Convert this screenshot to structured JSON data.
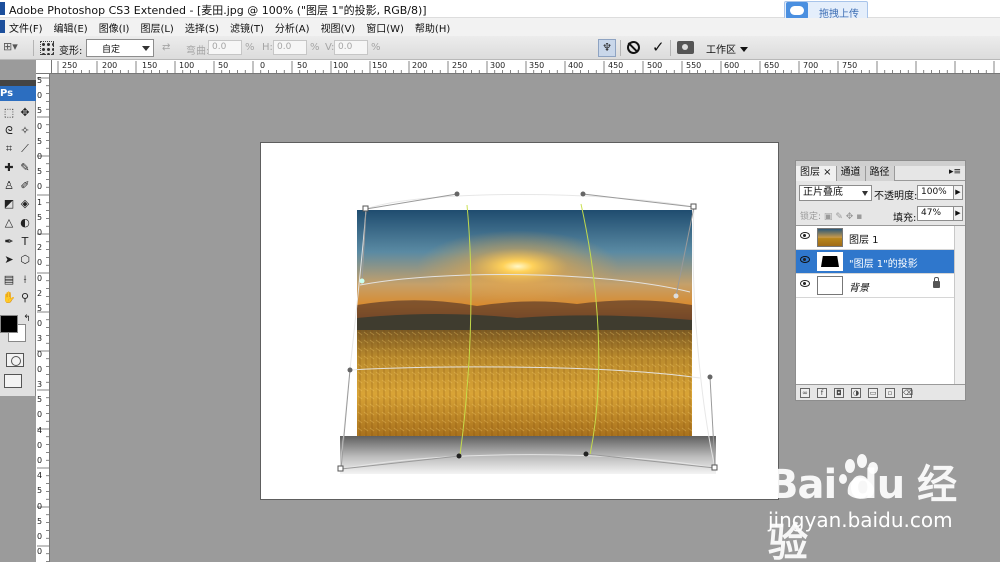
{
  "window": {
    "title": "Adobe Photoshop CS3 Extended - [麦田.jpg @ 100% (\"图层 1\"的投影, RGB/8)]",
    "upload_button": "拖拽上传"
  },
  "menu": {
    "items": [
      "文件(F)",
      "编辑(E)",
      "图像(I)",
      "图层(L)",
      "选择(S)",
      "滤镜(T)",
      "分析(A)",
      "视图(V)",
      "窗口(W)",
      "帮助(H)"
    ]
  },
  "options_bar": {
    "warp_label": "变形:",
    "warp_value": "自定",
    "bend_label": "弯曲:",
    "bend_value": "0.0",
    "h_label": "H:",
    "h_value": "0.0",
    "v_label": "V:",
    "v_value": "0.0",
    "percent": "%",
    "workspace_label": "工作区"
  },
  "toolbox": {
    "logo": "Ps"
  },
  "rulers": {
    "horizontal": [
      "250",
      "200",
      "150",
      "100",
      "50",
      "0",
      "50",
      "100",
      "150",
      "200",
      "250",
      "300",
      "350",
      "400",
      "450",
      "500",
      "550",
      "600",
      "650",
      "700",
      "750"
    ],
    "vertical": [
      "5",
      "0",
      "5",
      "0",
      "5",
      "0",
      "5",
      "0",
      "1",
      "5",
      "0",
      "2",
      "0",
      "0",
      "2",
      "5",
      "0",
      "3",
      "0",
      "0",
      "3",
      "5",
      "0",
      "4",
      "0",
      "0",
      "4",
      "5",
      "0",
      "5",
      "0",
      "0"
    ]
  },
  "layers_panel": {
    "tabs": [
      "图层 ×",
      "通道",
      "路径"
    ],
    "blend_mode": "正片叠底",
    "opacity_label": "不透明度:",
    "opacity_value": "100%",
    "lock_label": "锁定:",
    "fill_label": "填充:",
    "fill_value": "47%",
    "layers": [
      {
        "name": "图层 1",
        "selected": false,
        "locked": false,
        "italic": false
      },
      {
        "name": "\"图层 1\"的投影",
        "selected": true,
        "locked": false,
        "italic": false
      },
      {
        "name": "背景",
        "selected": false,
        "locked": true,
        "italic": true
      }
    ]
  },
  "watermark": {
    "brand": "Bai du 经验",
    "url": "jingyan.baidu.com"
  },
  "colors": {
    "selection_blue": "#2f77cc",
    "canvas_gray": "#9b9b9b"
  }
}
